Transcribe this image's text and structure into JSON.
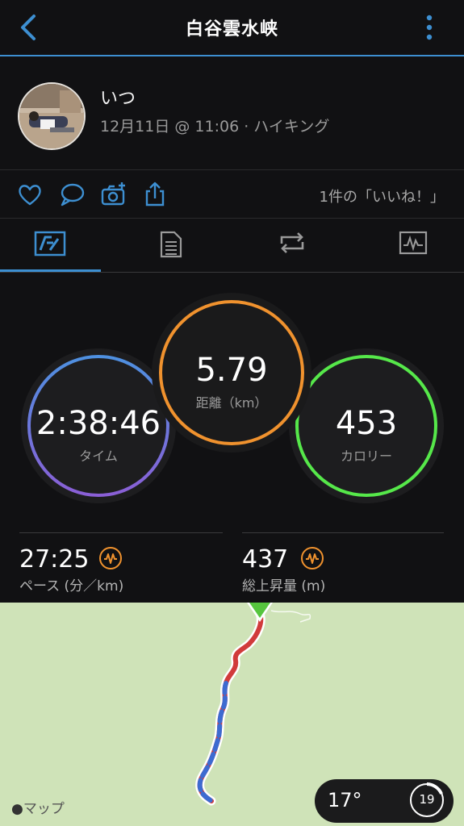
{
  "header": {
    "title": "白谷雲水峡"
  },
  "user": {
    "name": "いつ",
    "meta": "12月11日 @ 11:06 · ハイキング"
  },
  "social": {
    "likes_text": "1件の「いいね！」"
  },
  "tabs": [
    "overview",
    "details",
    "laps",
    "charts"
  ],
  "stats": {
    "distance": {
      "value": "5.79",
      "label": "距離（km）"
    },
    "time": {
      "value": "2:38:46",
      "label": "タイム"
    },
    "calories": {
      "value": "453",
      "label": "カロリー"
    },
    "pace": {
      "value": "27:25",
      "label": "ペース (分／km)"
    },
    "ascent": {
      "value": "437",
      "label": "総上昇量 (m)"
    }
  },
  "map": {
    "provider": "マップ",
    "temperature": "17°",
    "uv_value": "19"
  },
  "colors": {
    "accent": "#3d8fd1",
    "distance_ring": "#f0922e",
    "time_ring_top": "#4e90e0",
    "time_ring_bottom": "#8a5fd6",
    "calorie_ring": "#56e84a",
    "route_red": "#d13b3b",
    "route_blue": "#3d6bd1"
  }
}
